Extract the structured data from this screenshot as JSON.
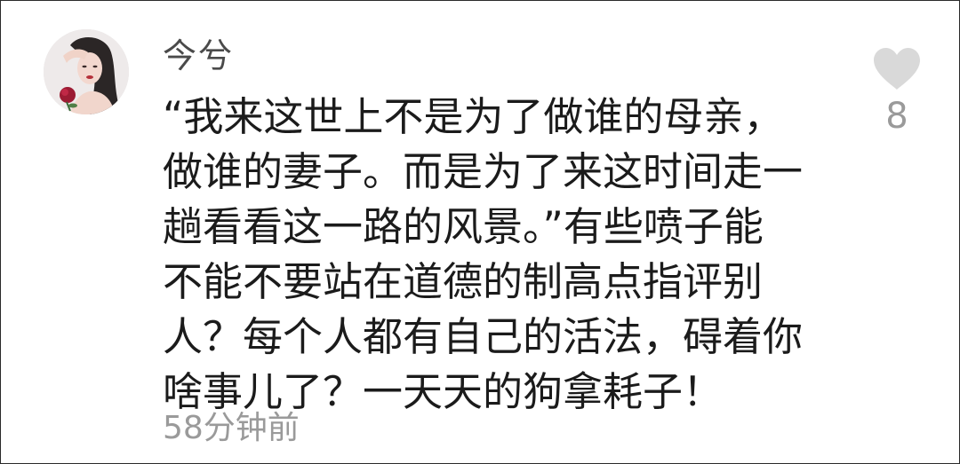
{
  "comment": {
    "username": "今兮",
    "text_lines": [
      "“我来这世上不是为了做谁的母亲，",
      "做谁的妻子。而是为了来这时间走一",
      "趟看看这一路的风景。”有些喷子能",
      "不能不要站在道德的制高点指评别",
      "人？每个人都有自己的活法，碍着你",
      "啥事儿了？一天天的狗拿耗子！"
    ],
    "timestamp": "58分钟前",
    "likes": {
      "count": "8",
      "icon": "heart-icon"
    },
    "avatar": {
      "icon": "avatar"
    }
  },
  "colors": {
    "text": "#1b1b1b",
    "username": "#4a4a4a",
    "muted": "#9a9a9a",
    "heart": "#d9d9d9",
    "frame": "#2a2a2a"
  }
}
